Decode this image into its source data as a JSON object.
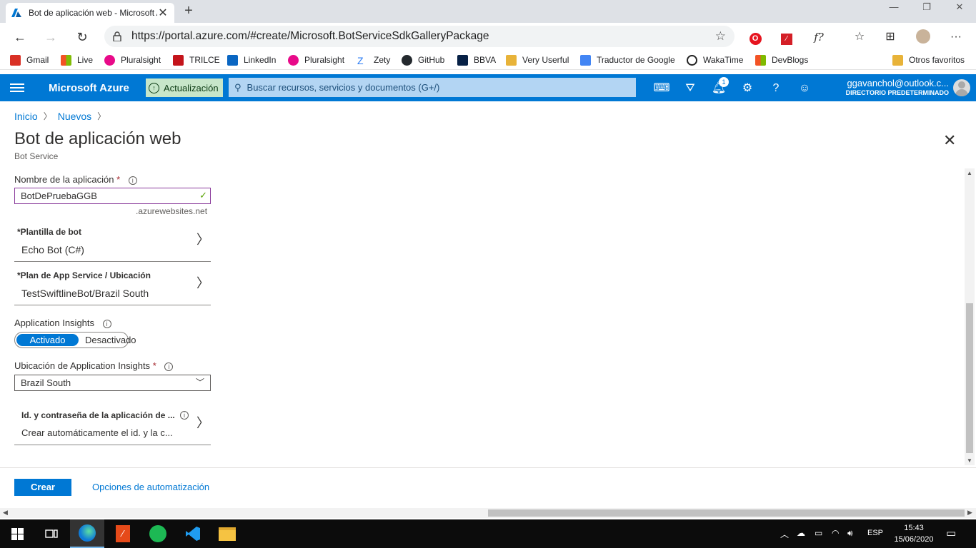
{
  "browser": {
    "tab_title": "Bot de aplicación web - Microsoft Azure",
    "tab_close": "✕",
    "new_tab": "+",
    "url": "https://portal.azure.com/#create/Microsoft.BotServiceSdkGalleryPackage",
    "window_controls": [
      "—",
      "❐",
      "✕"
    ],
    "icons": [
      "back-icon",
      "forward-icon",
      "refresh-icon",
      "lock-icon",
      "star-icon",
      "opera-icon",
      "pdf-icon",
      "formula-icon",
      "favorites-icon",
      "collections-icon",
      "profile-icon",
      "more-icon"
    ]
  },
  "favorites": [
    {
      "label": "Gmail",
      "color": "#d93025"
    },
    {
      "label": "Live",
      "color": "#f35325"
    },
    {
      "label": "Pluralsight",
      "color": "#e80a89"
    },
    {
      "label": "TRILCE",
      "color": "#c4141b"
    },
    {
      "label": "LinkedIn",
      "color": "#0a66c2"
    },
    {
      "label": "Pluralsight",
      "color": "#e80a89"
    },
    {
      "label": "Zety",
      "color": "#2a7bf4"
    },
    {
      "label": "GitHub",
      "color": "#24292e"
    },
    {
      "label": "BBVA",
      "color": "#072146"
    },
    {
      "label": "Very Userful",
      "color": "#e8b339"
    },
    {
      "label": "Traductor de Google",
      "color": "#4285f4"
    },
    {
      "label": "WakaTime",
      "color": "#222222"
    },
    {
      "label": "DevBlogs",
      "color": "#7fba00"
    },
    {
      "label": "Otros favoritos",
      "color": "#e8b339"
    }
  ],
  "azure_header": {
    "brand": "Microsoft Azure",
    "update_label": "Actualización",
    "search_placeholder": "Buscar recursos, servicios y documentos (G+/)",
    "notification_count": "1",
    "user_email": "ggavanchol@outlook.c...",
    "user_directory": "DIRECTORIO PREDETERMINADO",
    "accent_color": "#0078d4"
  },
  "breadcrumb": [
    "Inicio",
    "Nuevos"
  ],
  "page": {
    "title": "Bot de aplicación web",
    "subtitle": "Bot Service"
  },
  "form": {
    "app_name_label": "Nombre de la aplicación",
    "required_mark": "*",
    "app_name_value": "BotDePruebaGGB",
    "app_name_suffix": ".azurewebsites.net",
    "template_label": "*Plantilla de bot",
    "template_value": "Echo Bot (C#)",
    "plan_label": "*Plan de App Service / Ubicación",
    "plan_value": "TestSwiftlineBot/Brazil South",
    "insights_label": "Application Insights",
    "insights_on": "Activado",
    "insights_off": "Desactivado",
    "insights_location_label": "Ubicación de Application Insights",
    "insights_location_value": "Brazil South",
    "app_id_label": "Id. y contraseña de la aplicación de ...",
    "app_id_value": "Crear automáticamente el id. y la c..."
  },
  "footer": {
    "create_button": "Crear",
    "automation_link": "Opciones de automatización"
  },
  "taskbar": {
    "language": "ESP",
    "time": "15:43",
    "date": "15/06/2020"
  }
}
